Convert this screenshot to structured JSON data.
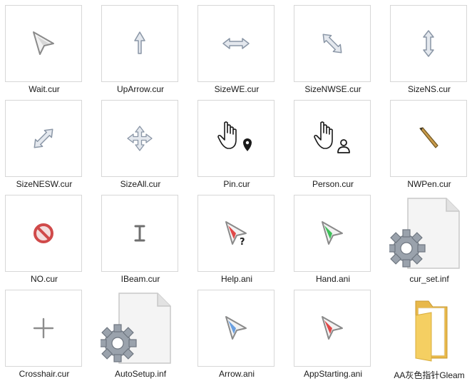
{
  "files": [
    {
      "name": "Wait.cur",
      "icon": "arrow-cursor-icon"
    },
    {
      "name": "UpArrow.cur",
      "icon": "up-arrow-cursor-icon"
    },
    {
      "name": "SizeWE.cur",
      "icon": "resize-horizontal-icon"
    },
    {
      "name": "SizeNWSE.cur",
      "icon": "resize-nwse-icon"
    },
    {
      "name": "SizeNS.cur",
      "icon": "resize-vertical-icon"
    },
    {
      "name": "SizeNESW.cur",
      "icon": "resize-nesw-icon"
    },
    {
      "name": "SizeAll.cur",
      "icon": "move-cursor-icon"
    },
    {
      "name": "Pin.cur",
      "icon": "hand-pin-cursor-icon"
    },
    {
      "name": "Person.cur",
      "icon": "hand-person-cursor-icon"
    },
    {
      "name": "NWPen.cur",
      "icon": "pen-cursor-icon"
    },
    {
      "name": "NO.cur",
      "icon": "not-allowed-cursor-icon"
    },
    {
      "name": "IBeam.cur",
      "icon": "ibeam-cursor-icon"
    },
    {
      "name": "Help.ani",
      "icon": "help-cursor-icon"
    },
    {
      "name": "Hand.ani",
      "icon": "green-arrow-cursor-icon"
    },
    {
      "name": "cur_set.inf",
      "icon": "settings-file-icon"
    },
    {
      "name": "Crosshair.cur",
      "icon": "crosshair-cursor-icon"
    },
    {
      "name": "AutoSetup.inf",
      "icon": "settings-file-icon"
    },
    {
      "name": "Arrow.ani",
      "icon": "blue-arrow-cursor-icon"
    },
    {
      "name": "AppStarting.ani",
      "icon": "red-arrow-cursor-icon"
    },
    {
      "name": "AA灰色指针Gleam",
      "icon": "folder-icon"
    }
  ]
}
